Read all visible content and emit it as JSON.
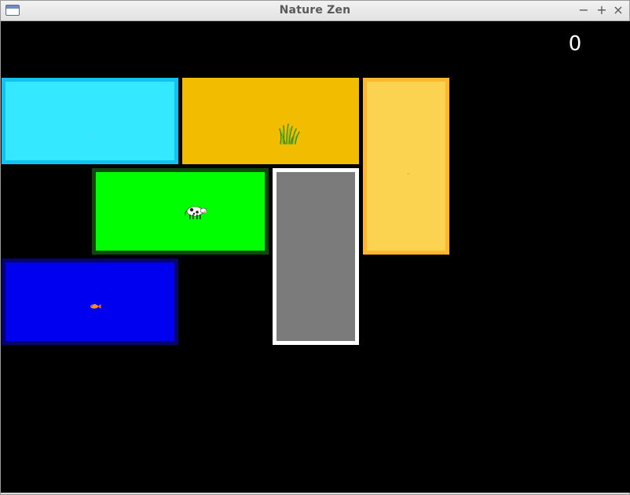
{
  "window": {
    "title": "Nature Zen",
    "controls": {
      "minimize": "−",
      "maximize": "+",
      "close": "×"
    }
  },
  "game": {
    "score": "0",
    "tiles": [
      {
        "name": "cyan-tile",
        "fill": "#33e8ff",
        "border": "#12c2f0",
        "icon": "tiny-dot-icon"
      },
      {
        "name": "amber-tile",
        "fill": "#f2bd00",
        "border": "#f2bd00",
        "icon": "grass-icon"
      },
      {
        "name": "yellow-tile",
        "fill": "#fcd350",
        "border": "#ffb730",
        "icon": "faint-icon"
      },
      {
        "name": "green-tile",
        "fill": "#00ff00",
        "border": "#0c4a0c",
        "icon": "cow-icon"
      },
      {
        "name": "gray-tile",
        "fill": "#7b7b7b",
        "border": "#ffffff",
        "icon": ""
      },
      {
        "name": "blue-tile",
        "fill": "#0000f0",
        "border": "#05056a",
        "icon": "fish-icon"
      }
    ]
  }
}
